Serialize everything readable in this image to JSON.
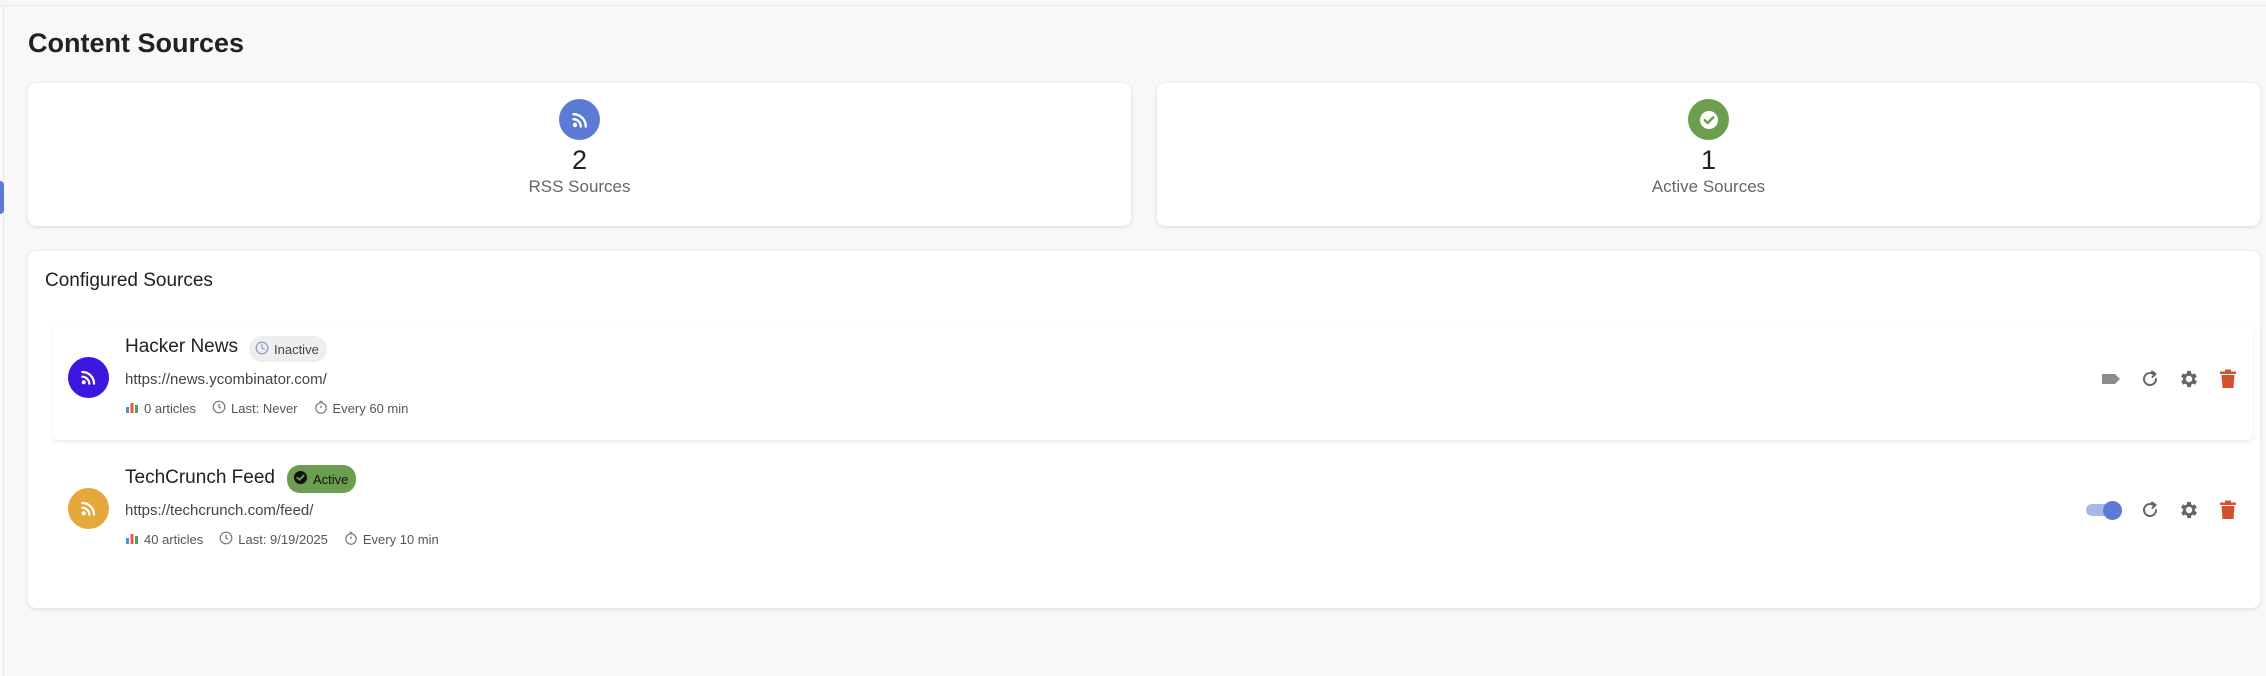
{
  "page": {
    "title": "Content Sources"
  },
  "stats": [
    {
      "icon": "rss-icon",
      "value": "2",
      "label": "RSS Sources",
      "color": "#5b7bd5"
    },
    {
      "icon": "check-circle-icon",
      "value": "1",
      "label": "Active Sources",
      "color": "#6b9e4e"
    }
  ],
  "configured": {
    "title": "Configured Sources",
    "sources": [
      {
        "name": "Hacker News",
        "status": "Inactive",
        "status_icon": "clock-icon",
        "url": "https://news.ycombinator.com/",
        "articles": "0 articles",
        "last": "Last: Never",
        "frequency": "Every 60 min",
        "avatar_color": "#3d17e0",
        "enabled": false
      },
      {
        "name": "TechCrunch Feed",
        "status": "Active",
        "status_icon": "check-circle-icon",
        "url": "https://techcrunch.com/feed/",
        "articles": "40 articles",
        "last": "Last: 9/19/2025",
        "frequency": "Every 10 min",
        "avatar_color": "#e4a83b",
        "enabled": true
      }
    ]
  },
  "colors": {
    "delete": "#d0532f",
    "action_gray": "#666666",
    "toggle_on": "#5b7bd5"
  }
}
